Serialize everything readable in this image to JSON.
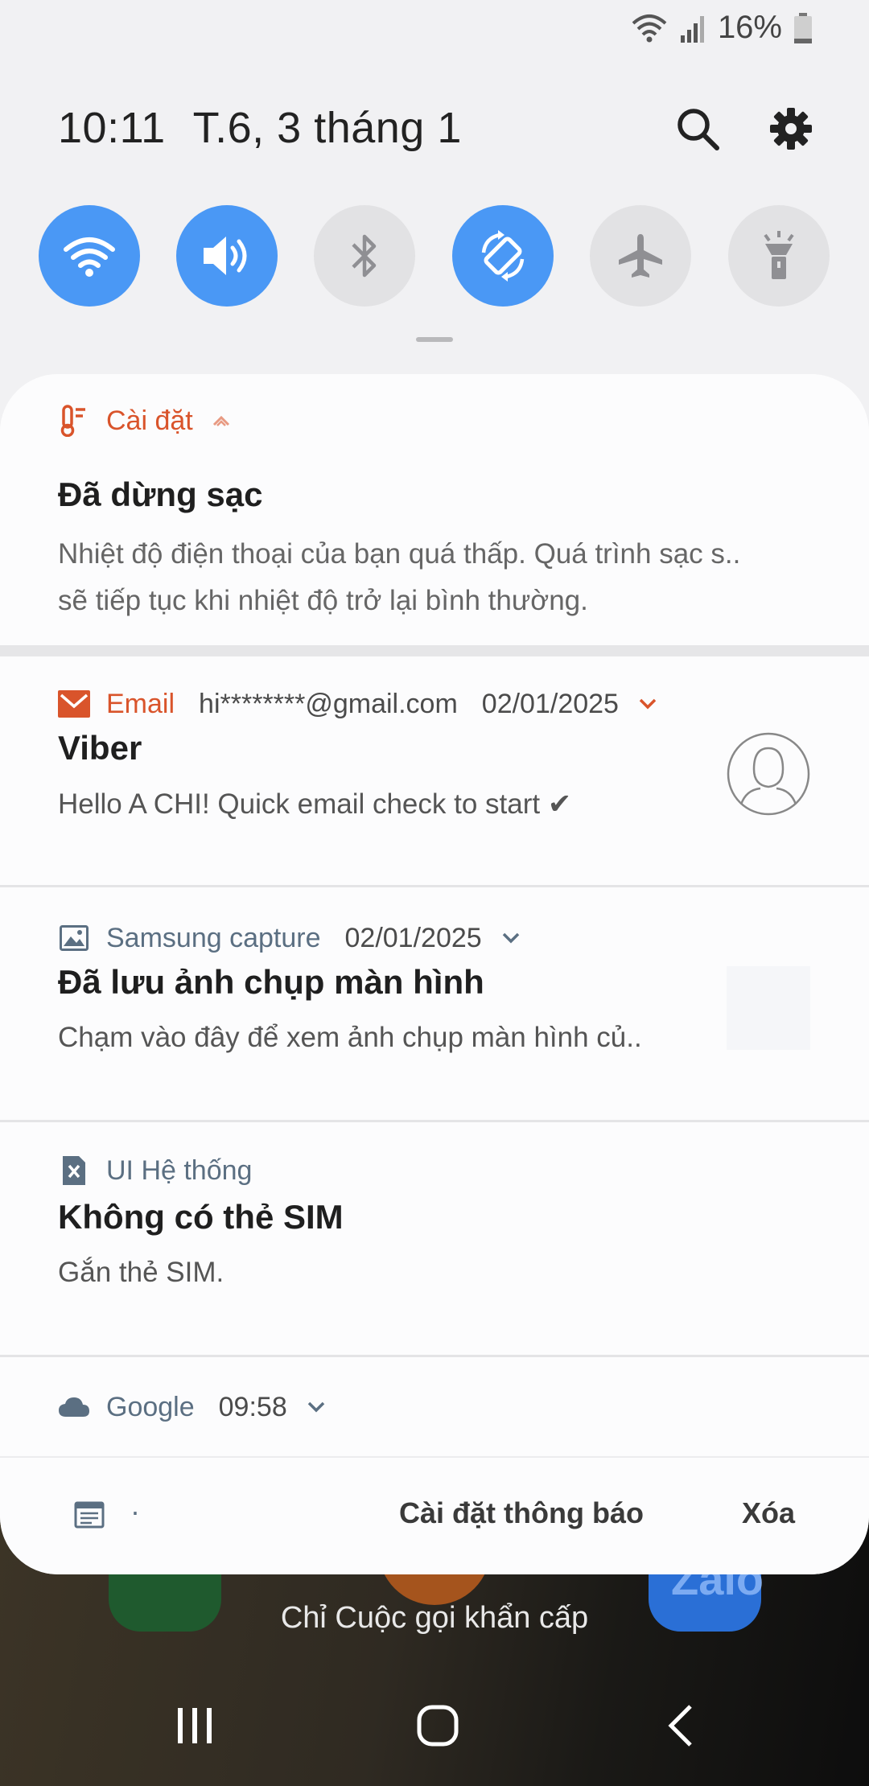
{
  "status": {
    "battery": "16%"
  },
  "header": {
    "time": "10:11",
    "date": "T.6, 3 tháng 1"
  },
  "quick_settings": [
    {
      "name": "wifi",
      "on": true
    },
    {
      "name": "sound",
      "on": true
    },
    {
      "name": "bluetooth",
      "on": false
    },
    {
      "name": "auto-rotate",
      "on": true
    },
    {
      "name": "airplane-mode",
      "on": false
    },
    {
      "name": "flashlight",
      "on": false
    }
  ],
  "notifications": {
    "settings": {
      "app": "Cài đặt",
      "title": "Đã dừng sạc",
      "body_line1": "Nhiệt độ điện thoại của bạn quá thấp. Quá trình sạc s..",
      "body_line2": "sẽ tiếp tục khi nhiệt độ trở lại bình thường.",
      "app_color": "#d9542b"
    },
    "email": {
      "app": "Email",
      "account": "hi********@gmail.com",
      "date": "02/01/2025",
      "title": "Viber",
      "body": "Hello A CHI! Quick email check to start ✔",
      "app_color": "#d9542b"
    },
    "capture": {
      "app": "Samsung capture",
      "date": "02/01/2025",
      "title": "Đã lưu ảnh chụp màn hình",
      "body": "Chạm vào đây để xem ảnh chụp màn hình củ..",
      "app_color": "#5b6f82"
    },
    "system": {
      "app": "UI Hệ thống",
      "title": "Không có thẻ SIM",
      "body": "Gắn thẻ SIM.",
      "app_color": "#5b6f82"
    },
    "google": {
      "app": "Google",
      "time": "09:58",
      "app_color": "#5b6f82"
    }
  },
  "footer": {
    "dot": "·",
    "notification_settings": "Cài đặt thông báo",
    "clear": "Xóa"
  },
  "lockscreen": {
    "emergency_text": "Chỉ Cuộc gọi khẩn cấp",
    "zalo_label": "Zalo"
  }
}
